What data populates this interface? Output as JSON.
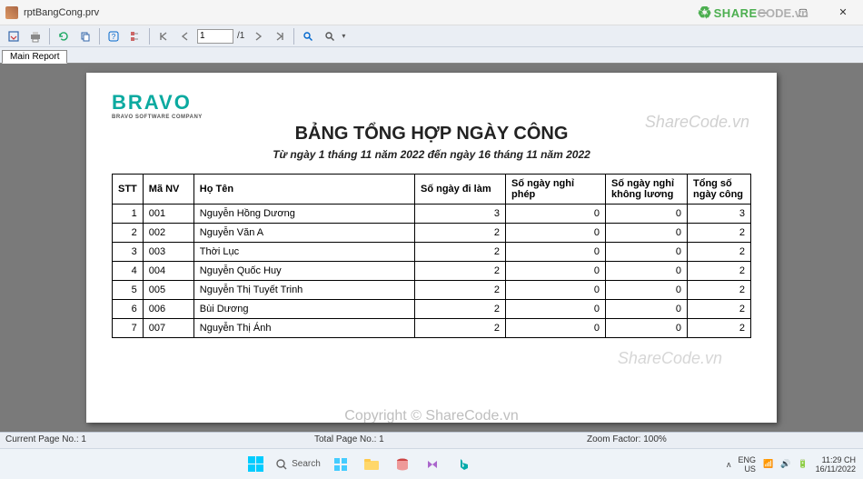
{
  "window": {
    "title": "rptBangCong.prv"
  },
  "win_controls": {
    "min": "—",
    "max": "▢",
    "close": "✕"
  },
  "toolbar": {
    "page_value": "1",
    "page_total": "/1"
  },
  "tab": {
    "label": "Main Report"
  },
  "watermarks": {
    "top": "ShareCode.vn",
    "mid": "ShareCode.vn",
    "copyright": "Copyright © ShareCode.vn"
  },
  "brand_overlay": {
    "name": "SHARE",
    "suffix": "CODE.vn"
  },
  "report": {
    "logo": "BRAVO",
    "logo_sub": "BRAVO SOFTWARE COMPANY",
    "title": "BẢNG TỔNG HỢP NGÀY CÔNG",
    "subtitle": "Từ ngày 1 tháng 11 năm 2022 đến ngày 16 tháng 11 năm 2022",
    "headers": {
      "stt": "STT",
      "manv": "Mã NV",
      "hoten": "Họ Tên",
      "dilam": "Số ngày đi làm",
      "nghiphep": "Số ngày nghỉ phép",
      "khongluong": "Số ngày nghỉ không lương",
      "tong": "Tổng số ngày công"
    },
    "rows": [
      {
        "stt": "1",
        "manv": "001",
        "hoten": "Nguyễn Hồng Dương",
        "dilam": "3",
        "nghiphep": "0",
        "khongluong": "0",
        "tong": "3"
      },
      {
        "stt": "2",
        "manv": "002",
        "hoten": "Nguyễn Văn A",
        "dilam": "2",
        "nghiphep": "0",
        "khongluong": "0",
        "tong": "2"
      },
      {
        "stt": "3",
        "manv": "003",
        "hoten": "Thời Lục",
        "dilam": "2",
        "nghiphep": "0",
        "khongluong": "0",
        "tong": "2"
      },
      {
        "stt": "4",
        "manv": "004",
        "hoten": "Nguyễn Quốc Huy",
        "dilam": "2",
        "nghiphep": "0",
        "khongluong": "0",
        "tong": "2"
      },
      {
        "stt": "5",
        "manv": "005",
        "hoten": "Nguyễn Thị Tuyết Trinh",
        "dilam": "2",
        "nghiphep": "0",
        "khongluong": "0",
        "tong": "2"
      },
      {
        "stt": "6",
        "manv": "006",
        "hoten": "Bùi Dương",
        "dilam": "2",
        "nghiphep": "0",
        "khongluong": "0",
        "tong": "2"
      },
      {
        "stt": "7",
        "manv": "007",
        "hoten": "Nguyễn Thị Ánh",
        "dilam": "2",
        "nghiphep": "0",
        "khongluong": "0",
        "tong": "2"
      }
    ]
  },
  "status": {
    "current": "Current Page No.: 1",
    "total": "Total Page No.: 1",
    "zoom": "Zoom Factor: 100%"
  },
  "taskbar": {
    "search_placeholder": "Search",
    "lang1": "ENG",
    "lang2": "US",
    "time": "11:29 CH",
    "date": "16/11/2022"
  }
}
